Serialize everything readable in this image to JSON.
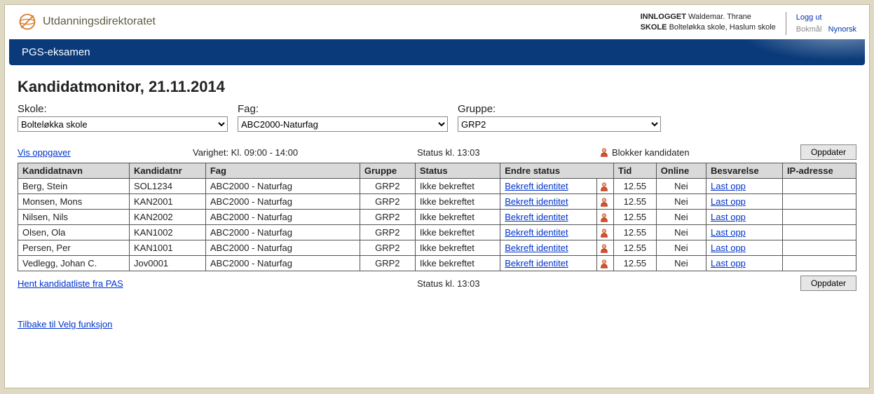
{
  "brand": "Utdanningsdirektoratet",
  "login": {
    "logged_label": "INNLOGGET",
    "user": "Waldemar. Thrane",
    "school_label": "SKOLE",
    "school": "Bolteløkka skole, Haslum skole"
  },
  "lang": {
    "logout": "Logg ut",
    "bokmal": "Bokmål",
    "nynorsk": "Nynorsk"
  },
  "banner": "PGS-eksamen",
  "title": "Kandidatmonitor, 21.11.2014",
  "filters": {
    "skole_label": "Skole:",
    "skole_value": "Bolteløkka skole",
    "fag_label": "Fag:",
    "fag_value": "ABC2000-Naturfag",
    "gruppe_label": "Gruppe:",
    "gruppe_value": "GRP2"
  },
  "meta": {
    "vis_oppgaver": "Vis oppgaver",
    "varighet": "Varighet: Kl. 09:00 - 14:00",
    "status_time": "Status kl. 13:03",
    "blokker": "Blokker kandidaten",
    "oppdater": "Oppdater"
  },
  "columns": {
    "navn": "Kandidatnavn",
    "nr": "Kandidatnr",
    "fag": "Fag",
    "gruppe": "Gruppe",
    "status": "Status",
    "endre": "Endre status",
    "blank": "",
    "tid": "Tid",
    "online": "Online",
    "besv": "Besvarelse",
    "ip": "IP-adresse"
  },
  "rows": [
    {
      "navn": "Berg, Stein",
      "nr": "SOL1234",
      "fag": "ABC2000 - Naturfag",
      "gruppe": "GRP2",
      "status": "Ikke bekreftet",
      "endre": "Bekreft identitet",
      "tid": "12.55",
      "online": "Nei",
      "besv": "Last opp",
      "ip": ""
    },
    {
      "navn": "Monsen, Mons",
      "nr": "KAN2001",
      "fag": "ABC2000 - Naturfag",
      "gruppe": "GRP2",
      "status": "Ikke bekreftet",
      "endre": "Bekreft identitet",
      "tid": "12.55",
      "online": "Nei",
      "besv": "Last opp",
      "ip": ""
    },
    {
      "navn": "Nilsen, Nils",
      "nr": "KAN2002",
      "fag": "ABC2000 - Naturfag",
      "gruppe": "GRP2",
      "status": "Ikke bekreftet",
      "endre": "Bekreft identitet",
      "tid": "12.55",
      "online": "Nei",
      "besv": "Last opp",
      "ip": ""
    },
    {
      "navn": "Olsen, Ola",
      "nr": "KAN1002",
      "fag": "ABC2000 - Naturfag",
      "gruppe": "GRP2",
      "status": "Ikke bekreftet",
      "endre": "Bekreft identitet",
      "tid": "12.55",
      "online": "Nei",
      "besv": "Last opp",
      "ip": ""
    },
    {
      "navn": "Persen, Per",
      "nr": "KAN1001",
      "fag": "ABC2000 - Naturfag",
      "gruppe": "GRP2",
      "status": "Ikke bekreftet",
      "endre": "Bekreft identitet",
      "tid": "12.55",
      "online": "Nei",
      "besv": "Last opp",
      "ip": ""
    },
    {
      "navn": "Vedlegg, Johan C.",
      "nr": "Jov0001",
      "fag": "ABC2000 - Naturfag",
      "gruppe": "GRP2",
      "status": "Ikke bekreftet",
      "endre": "Bekreft identitet",
      "tid": "12.55",
      "online": "Nei",
      "besv": "Last opp",
      "ip": ""
    }
  ],
  "footer": {
    "hent": "Hent kandidatliste fra PAS",
    "status_time": "Status kl. 13:03",
    "oppdater": "Oppdater",
    "tilbake": "Tilbake til Velg funksjon"
  }
}
